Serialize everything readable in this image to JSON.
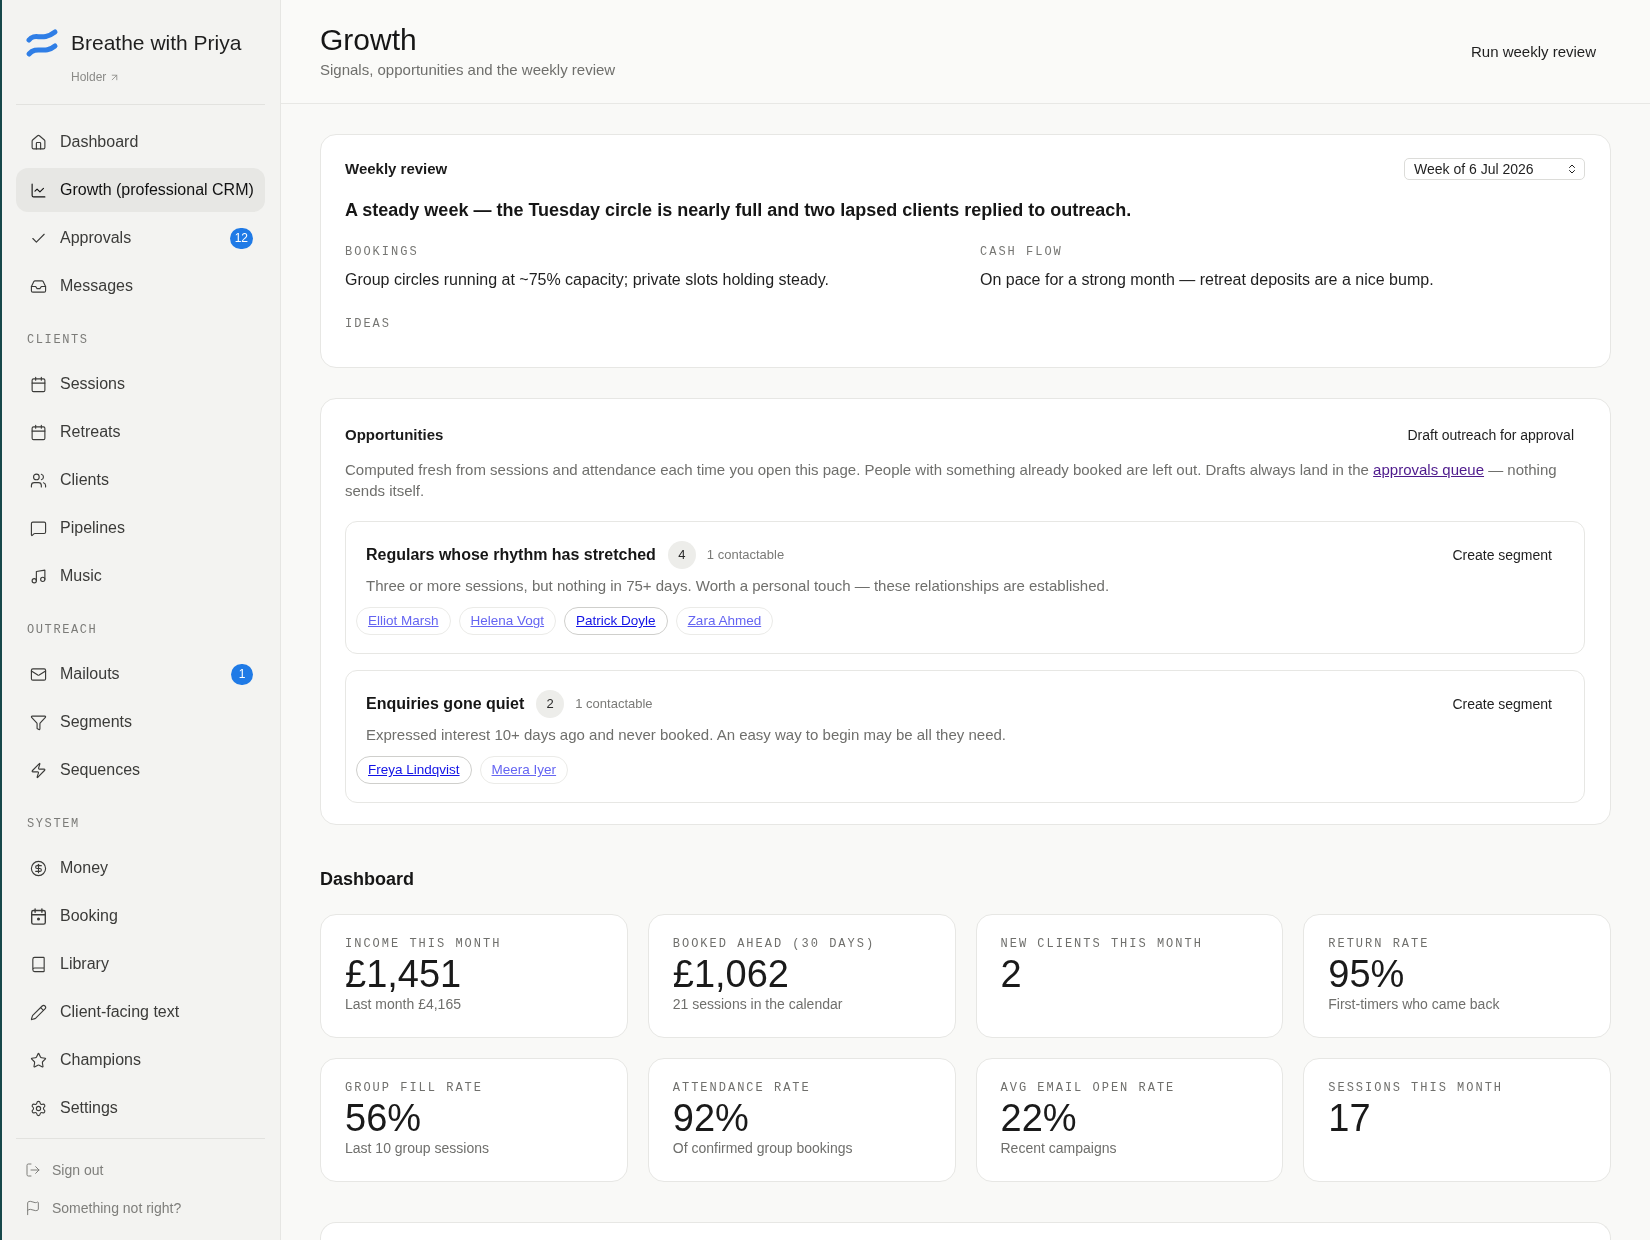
{
  "sidebar": {
    "brand": {
      "name": "Breathe with Priya",
      "link": "Holder"
    },
    "nav_sections": [
      {
        "items": [
          {
            "label": "Dashboard",
            "selected": false
          },
          {
            "label": "Growth (professional CRM)",
            "selected": true
          },
          {
            "label": "Approvals",
            "selected": false,
            "badge": "12"
          },
          {
            "label": "Messages",
            "selected": false
          }
        ]
      },
      {
        "heading": "CLIENTS",
        "items": [
          {
            "label": "Sessions",
            "selected": false
          },
          {
            "label": "Retreats",
            "selected": false
          },
          {
            "label": "Clients",
            "selected": false
          },
          {
            "label": "Pipelines",
            "selected": false
          },
          {
            "label": "Music",
            "selected": false
          }
        ]
      },
      {
        "heading": "OUTREACH",
        "items": [
          {
            "label": "Mailouts",
            "selected": false,
            "badge": "1"
          },
          {
            "label": "Segments",
            "selected": false
          },
          {
            "label": "Sequences",
            "selected": false
          }
        ]
      },
      {
        "heading": "SYSTEM",
        "items": [
          {
            "label": "Money",
            "selected": false
          },
          {
            "label": "Booking",
            "selected": false
          },
          {
            "label": "Library",
            "selected": false
          },
          {
            "label": "Client-facing text",
            "selected": false
          },
          {
            "label": "Champions",
            "selected": false
          },
          {
            "label": "Settings",
            "selected": false
          }
        ]
      }
    ],
    "footer_links": [
      "Sign out",
      "Something not right?"
    ]
  },
  "header": {
    "title": "Growth",
    "subtitle": "Signals, opportunities and the weekly review",
    "action": "Run weekly review"
  },
  "weekly_review": {
    "title": "Weekly review",
    "week_select": {
      "value": "Week of 6 Jul 2026"
    },
    "headline": "A steady week — the Tuesday circle is nearly full and two lapsed clients replied to outreach.",
    "sections": [
      {
        "label": "BOOKINGS",
        "text": "Group circles running at ~75% capacity; private slots holding steady."
      },
      {
        "label": "CASH FLOW",
        "text": "On pace for a strong month — retreat deposits are a nice bump."
      },
      {
        "label": "IDEAS"
      }
    ]
  },
  "opportunities": {
    "title": "Opportunities",
    "action": "Draft outreach for approval",
    "description": {
      "before": "Computed fresh from sessions and attendance each time you open this page. People with something already booked are left out. Drafts always land in the",
      "link": "approvals queue",
      "after": "— nothing sends itself."
    },
    "groups": [
      {
        "title": "Regulars whose rhythm has stretched",
        "count": "4",
        "note": "1 contactable",
        "action": "Create segment",
        "description": "Three or more sessions, but nothing in 75+ days. Worth a personal touch — these relationships are established.",
        "people": [
          {
            "name": "Elliot Marsh",
            "contactable": false
          },
          {
            "name": "Helena Vogt",
            "contactable": false
          },
          {
            "name": "Patrick Doyle",
            "contactable": true
          },
          {
            "name": "Zara Ahmed",
            "contactable": false
          }
        ]
      },
      {
        "title": "Enquiries gone quiet",
        "count": "2",
        "note": "1 contactable",
        "action": "Create segment",
        "description": "Expressed interest 10+ days ago and never booked. An easy way to begin may be all they need.",
        "people": [
          {
            "name": "Freya Lindqvist",
            "contactable": true
          },
          {
            "name": "Meera Iyer",
            "contactable": false
          }
        ]
      }
    ]
  },
  "dashboard": {
    "title": "Dashboard",
    "metrics": [
      {
        "label": "INCOME THIS MONTH",
        "value": "£1,451",
        "note": "Last month £4,165"
      },
      {
        "label": "BOOKED AHEAD (30 DAYS)",
        "value": "£1,062",
        "note": "21 sessions in the calendar"
      },
      {
        "label": "NEW CLIENTS THIS MONTH",
        "value": "2"
      },
      {
        "label": "RETURN RATE",
        "value": "95%",
        "note": "First-timers who came back"
      },
      {
        "label": "GROUP FILL RATE",
        "value": "56%",
        "note": "Last 10 group sessions"
      },
      {
        "label": "ATTENDANCE RATE",
        "value": "92%",
        "note": "Of confirmed group bookings"
      },
      {
        "label": "AVG EMAIL OPEN RATE",
        "value": "22%",
        "note": "Recent campaigns"
      },
      {
        "label": "SESSIONS THIS MONTH",
        "value": "17"
      }
    ]
  }
}
